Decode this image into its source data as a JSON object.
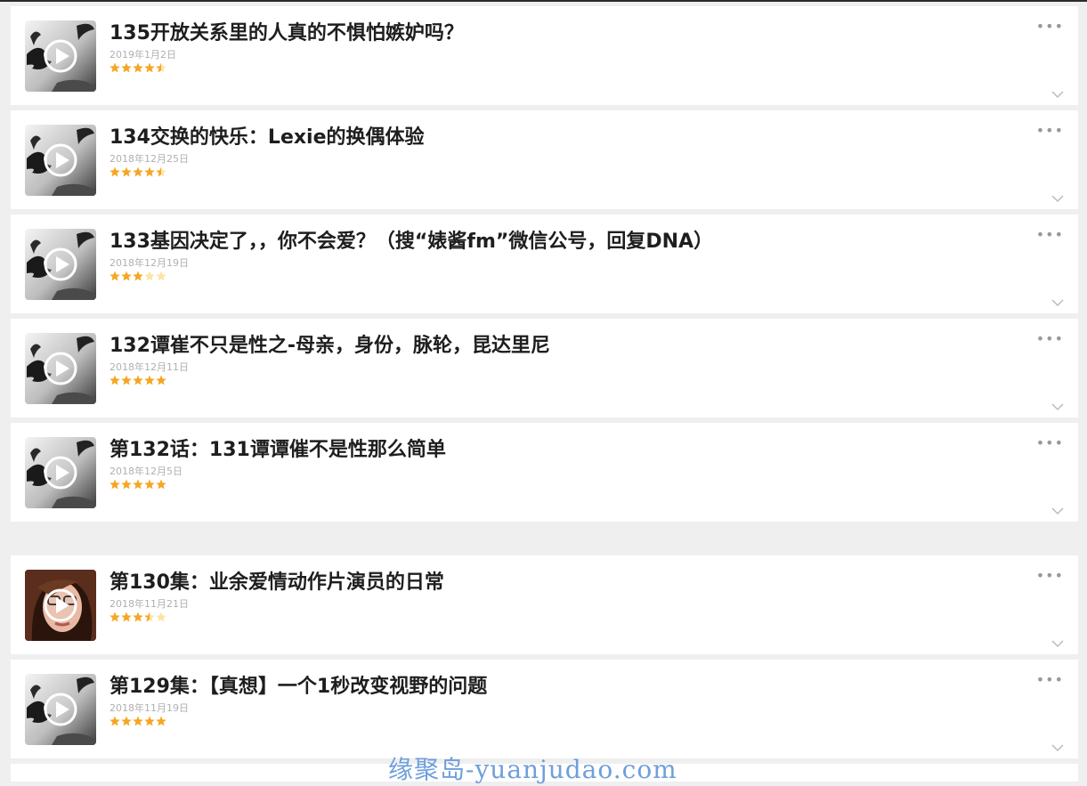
{
  "episodes": [
    {
      "title": "135开放关系里的人真的不惧怕嫉妒吗？",
      "date": "2019年1月2日",
      "rating": 4.5,
      "thumb": "bw-bird"
    },
    {
      "title": "134交换的快乐：Lexie的换偶体验",
      "date": "2018年12月25日",
      "rating": 4.5,
      "thumb": "bw-bird"
    },
    {
      "title": "133基因决定了，，你不会爱？（搜“婊酱fm”微信公号，回复DNA）",
      "date": "2018年12月19日",
      "rating": 3,
      "thumb": "bw-bird"
    },
    {
      "title": "132谭崔不只是性之-母亲，身份，脉轮，昆达里尼",
      "date": "2018年12月11日",
      "rating": 5,
      "thumb": "bw-bird"
    },
    {
      "title": "第132话：131谭谭催不是性那么简单",
      "date": "2018年12月5日",
      "rating": 5,
      "thumb": "bw-bird"
    },
    {
      "title": "第130集：业余爱情动作片演员的日常",
      "date": "2018年11月21日",
      "rating": 3.5,
      "thumb": "portrait"
    },
    {
      "title": "第129集：【真想】一个1秒改变视野的问题",
      "date": "2018年11月19日",
      "rating": 5,
      "thumb": "bw-bird"
    }
  ],
  "more_icon": "•••",
  "colors": {
    "star": "#f5a623",
    "star_empty": "#fde3a7",
    "title": "#1e1e1e"
  },
  "watermark": "缘聚岛-yuanjudao.com"
}
